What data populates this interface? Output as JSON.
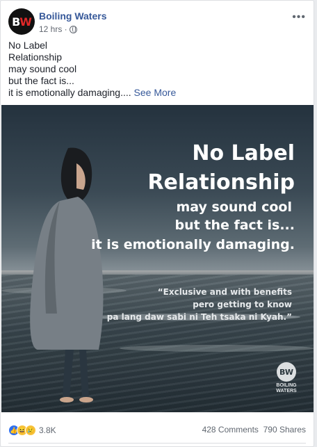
{
  "post": {
    "page_name": "Boiling Waters",
    "avatar": {
      "b": "B",
      "w": "W"
    },
    "time": "12 hrs ·",
    "privacy_icon": "globe-icon",
    "more_icon": "•••",
    "text_lines": [
      "No Label",
      "Relationship",
      "may sound cool",
      "but the fact is..."
    ],
    "last_line": "it is emotionally damaging....",
    "see_more": "See More"
  },
  "image": {
    "headline": [
      "No Label",
      "Relationship",
      "may sound cool",
      "but the fact is...",
      "it is emotionally damaging."
    ],
    "quote": [
      "“Exclusive and with benefits",
      "pero getting to know",
      "pa lang daw sabi ni Teh tsaka ni Kyah.”"
    ],
    "watermark_logo": "BW",
    "watermark_text": [
      "BOILING",
      "WATERS"
    ]
  },
  "footer": {
    "reaction_icons": [
      "like-icon",
      "haha-icon",
      "sad-icon"
    ],
    "reaction_count": "3.8K",
    "comments": "428 Comments",
    "shares": "790 Shares"
  }
}
